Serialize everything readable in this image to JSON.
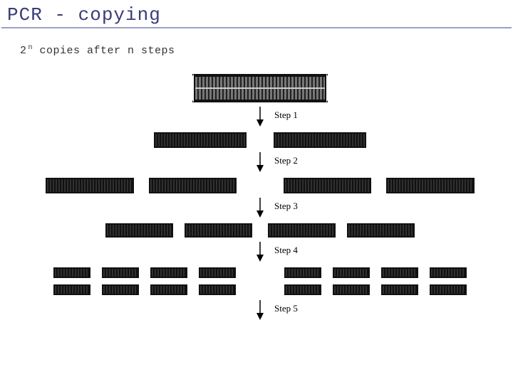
{
  "title": "PCR - copying",
  "subtitle_base": "2",
  "subtitle_exp": "n",
  "subtitle_rest": " copies after n steps",
  "steps": {
    "s1": "Step 1",
    "s2": "Step 2",
    "s3": "Step 3",
    "s4": "Step 4",
    "s5": "Step 5"
  }
}
